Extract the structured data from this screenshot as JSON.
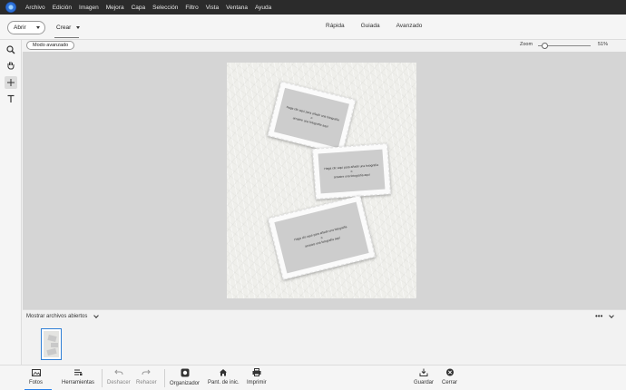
{
  "menubar": {
    "items": [
      "Archivo",
      "Edición",
      "Imagen",
      "Mejora",
      "Capa",
      "Selección",
      "Filtro",
      "Vista",
      "Ventana",
      "Ayuda"
    ]
  },
  "topbar": {
    "open_label": "Abrir",
    "create_label": "Crear",
    "modes": [
      "Rápida",
      "Guiada",
      "Avanzado"
    ]
  },
  "workspace": {
    "mode_button": "Modo avanzado",
    "zoom_label": "Zoom",
    "zoom_value": "51%",
    "zoom_fraction": 0.1
  },
  "document": {
    "placeholders": [
      {
        "line1": "Haga clic aquí para añadir una fotografía",
        "line2": "o",
        "line3": "arrastre una fotografía aquí"
      },
      {
        "line1": "Haga clic aquí para añadir una fotografía",
        "line2": "o",
        "line3": "arrastre una fotografía aquí"
      },
      {
        "line1": "Haga clic aquí para añadir una fotografía",
        "line2": "o",
        "line3": "arrastre una fotografía aquí"
      }
    ]
  },
  "bin": {
    "dropdown_label": "Mostrar archivos abiertos",
    "more_label": "•••"
  },
  "taskbar": {
    "items": [
      "Fotos",
      "Herramientas",
      "Deshacer",
      "Rehacer",
      "Organizador",
      "Pant. de inic.",
      "Imprimir",
      "Guardar",
      "Cerrar"
    ]
  },
  "colors": {
    "menubar_bg": "#2b2b2b",
    "accent": "#2680eb",
    "canvas_bg": "#d5d5d5"
  }
}
